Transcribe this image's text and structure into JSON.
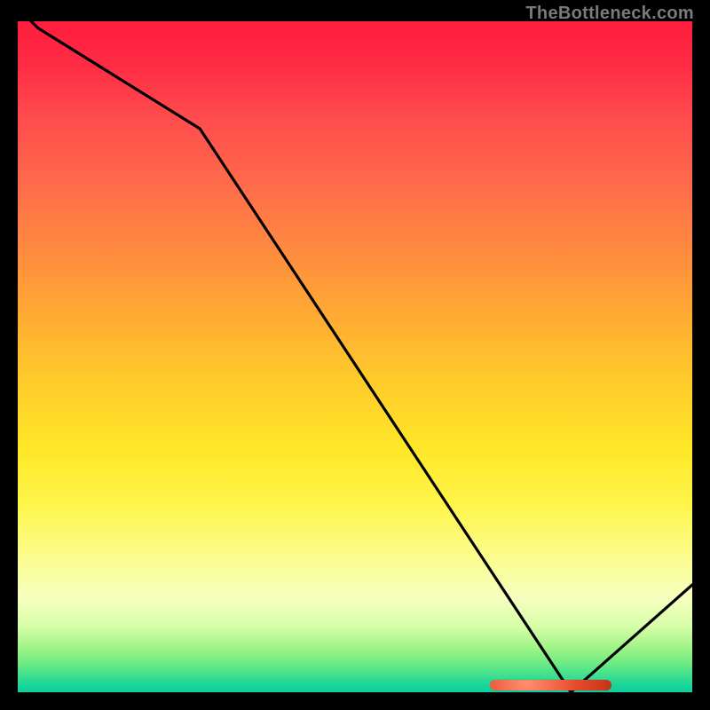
{
  "watermark": "TheBottleneck.com",
  "colors": {
    "background": "#000000",
    "line": "#000000",
    "pill": "#e64a2a"
  },
  "chart_data": {
    "type": "line",
    "title": "",
    "xlabel": "",
    "ylabel": "",
    "x": [
      0.0,
      0.03,
      0.27,
      0.82,
      1.0
    ],
    "values": [
      1.02,
      0.99,
      0.84,
      0.0,
      0.16
    ],
    "xlim": [
      0,
      1
    ],
    "ylim": [
      0,
      1
    ],
    "grid": false,
    "gradient_stops": [
      {
        "pos": 0.0,
        "color": "#ff1d3f"
      },
      {
        "pos": 0.5,
        "color": "#ffcc2a"
      },
      {
        "pos": 0.78,
        "color": "#fbfd8f"
      },
      {
        "pos": 0.93,
        "color": "#a7f58a"
      },
      {
        "pos": 1.0,
        "color": "#0fcf9e"
      }
    ],
    "pill_marker_x_range": [
      0.7,
      0.88
    ]
  }
}
